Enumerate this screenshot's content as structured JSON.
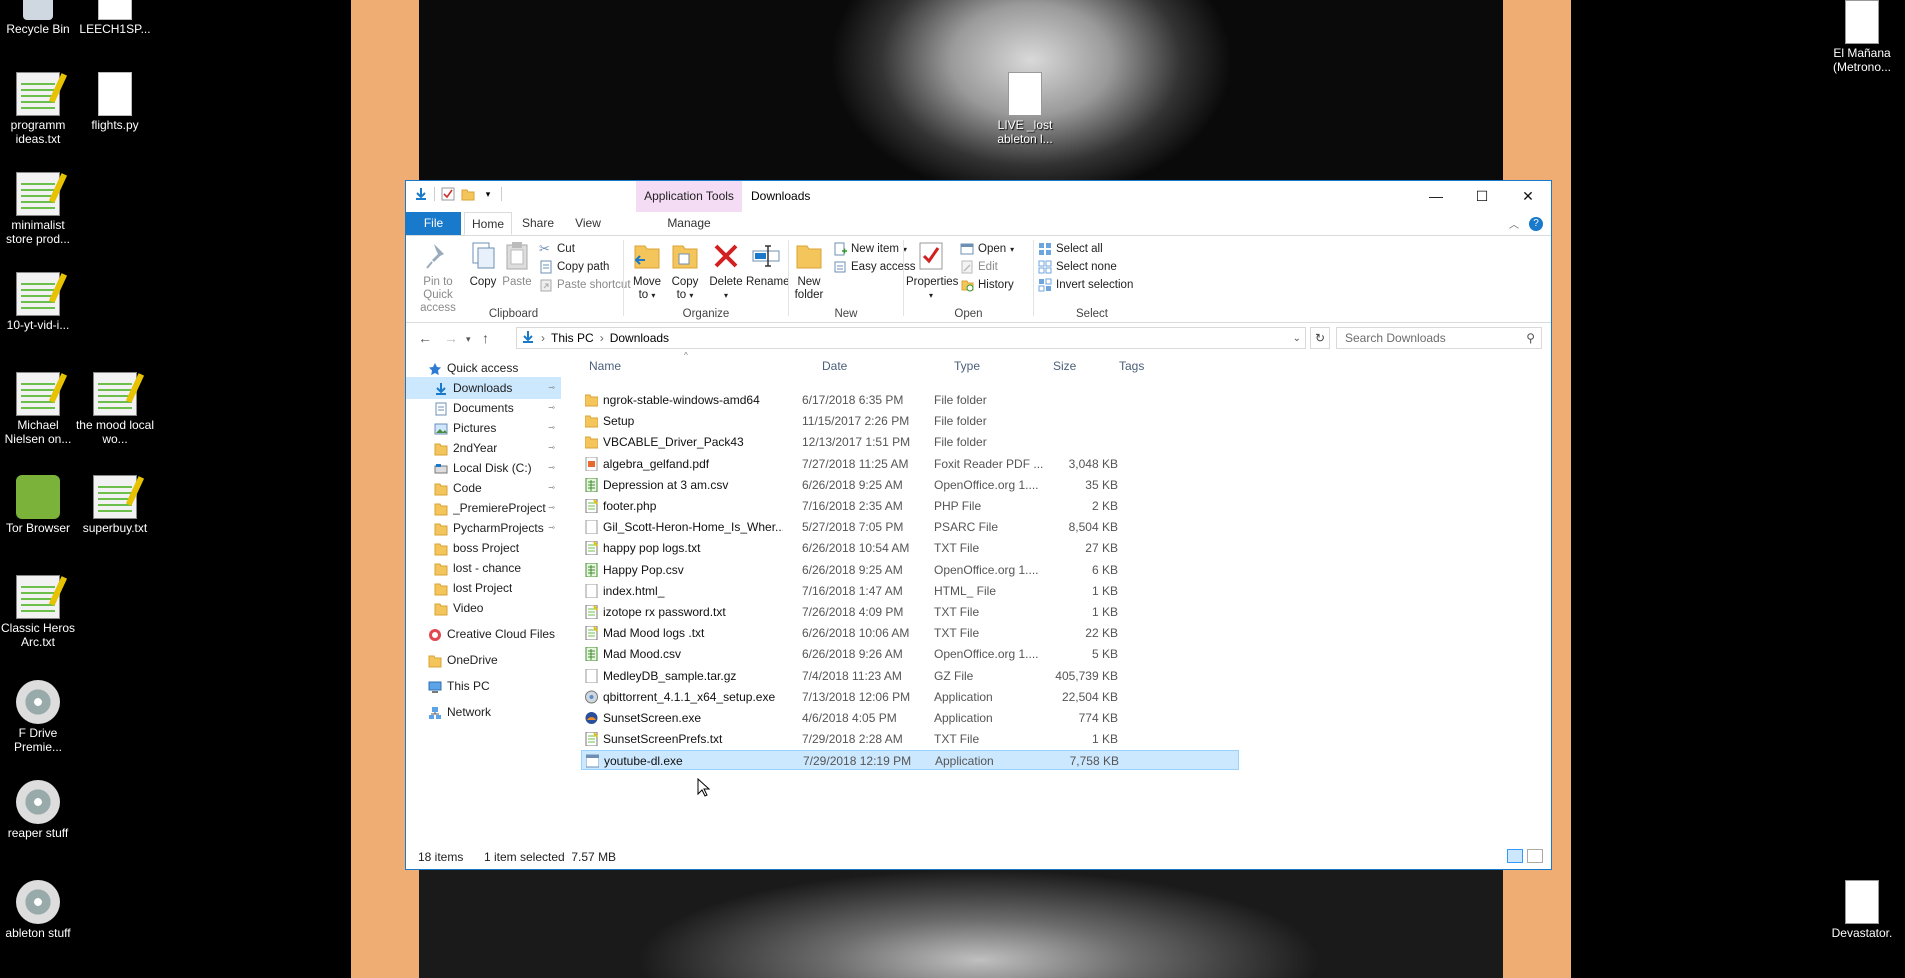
{
  "desktop": {
    "icons": [
      {
        "label": "Recycle Bin",
        "icon": "recycle-bin-icon"
      },
      {
        "label": "LEECH1SP...",
        "icon": "file-icon"
      },
      {
        "label": "programm ideas.txt",
        "icon": "notepad-icon"
      },
      {
        "label": "flights.py",
        "icon": "file-icon"
      },
      {
        "label": "minimalist store prod...",
        "icon": "notepad-icon"
      },
      {
        "label": "10-yt-vid-i...",
        "icon": "notepad-icon"
      },
      {
        "label": "Michael Nielsen on...",
        "icon": "notepad-icon"
      },
      {
        "label": "the mood local wo...",
        "icon": "notepad-icon"
      },
      {
        "label": "Tor Browser",
        "icon": "tor-icon"
      },
      {
        "label": "superbuy.txt",
        "icon": "notepad-icon"
      },
      {
        "label": "Classic Heros Arc.txt",
        "icon": "notepad-icon"
      },
      {
        "label": "F Drive Premie...",
        "icon": "disc-shortcut-icon"
      },
      {
        "label": "reaper stuff",
        "icon": "disc-shortcut-icon"
      },
      {
        "label": "ableton stuff",
        "icon": "disc-shortcut-icon"
      },
      {
        "label": "LIVE _lost ableton l...",
        "icon": "ableton-shortcut-icon"
      },
      {
        "label": "El Mañana (Metrono...",
        "icon": "music-file-icon"
      },
      {
        "label": "Devastator.",
        "icon": "music-file-icon"
      }
    ]
  },
  "window": {
    "title": "Downloads",
    "contextual_tab_group": "Application Tools",
    "controls": {
      "minimize": "—",
      "maximize": "☐",
      "close": "✕"
    },
    "tabs": {
      "file": "File",
      "home": "Home",
      "share": "Share",
      "view": "View",
      "manage": "Manage"
    },
    "ribbon": {
      "clipboard": {
        "label": "Clipboard",
        "pin": "Pin to Quick access",
        "copy": "Copy",
        "paste": "Paste",
        "cut": "Cut",
        "copy_path": "Copy path",
        "paste_shortcut": "Paste shortcut"
      },
      "organize": {
        "label": "Organize",
        "move_to": "Move to",
        "copy_to": "Copy to",
        "delete": "Delete",
        "rename": "Rename"
      },
      "new": {
        "label": "New",
        "new_folder": "New folder",
        "new_item": "New item",
        "easy_access": "Easy access"
      },
      "open": {
        "label": "Open",
        "properties": "Properties",
        "open": "Open",
        "edit": "Edit",
        "history": "History"
      },
      "select": {
        "label": "Select",
        "select_all": "Select all",
        "select_none": "Select none",
        "invert": "Invert selection"
      }
    },
    "address": {
      "crumbs": [
        "This PC",
        "Downloads"
      ],
      "search_placeholder": "Search Downloads"
    },
    "nav": [
      {
        "label": "Quick access",
        "indent": 0,
        "pinned": false,
        "selected": false,
        "icon": "star-icon"
      },
      {
        "label": "Downloads",
        "indent": 1,
        "pinned": true,
        "selected": true,
        "icon": "download-arrow-icon"
      },
      {
        "label": "Documents",
        "indent": 1,
        "pinned": true,
        "selected": false,
        "icon": "documents-icon"
      },
      {
        "label": "Pictures",
        "indent": 1,
        "pinned": true,
        "selected": false,
        "icon": "pictures-icon"
      },
      {
        "label": "2ndYear",
        "indent": 1,
        "pinned": true,
        "selected": false,
        "icon": "folder-icon"
      },
      {
        "label": "Local Disk (C:)",
        "indent": 1,
        "pinned": true,
        "selected": false,
        "icon": "drive-icon"
      },
      {
        "label": "Code",
        "indent": 1,
        "pinned": true,
        "selected": false,
        "icon": "folder-icon"
      },
      {
        "label": "_PremiereProject",
        "indent": 1,
        "pinned": true,
        "selected": false,
        "icon": "folder-icon"
      },
      {
        "label": "PycharmProjects",
        "indent": 1,
        "pinned": true,
        "selected": false,
        "icon": "folder-icon"
      },
      {
        "label": "boss Project",
        "indent": 1,
        "pinned": false,
        "selected": false,
        "icon": "folder-icon"
      },
      {
        "label": "lost - chance",
        "indent": 1,
        "pinned": false,
        "selected": false,
        "icon": "folder-icon"
      },
      {
        "label": "lost Project",
        "indent": 1,
        "pinned": false,
        "selected": false,
        "icon": "folder-icon"
      },
      {
        "label": "Video",
        "indent": 1,
        "pinned": false,
        "selected": false,
        "icon": "folder-icon"
      },
      {
        "label": "Creative Cloud Files",
        "indent": 0,
        "pinned": false,
        "selected": false,
        "icon": "creative-cloud-icon"
      },
      {
        "label": "OneDrive",
        "indent": 0,
        "pinned": false,
        "selected": false,
        "icon": "onedrive-icon"
      },
      {
        "label": "This PC",
        "indent": 0,
        "pinned": false,
        "selected": false,
        "icon": "computer-icon"
      },
      {
        "label": "Network",
        "indent": 0,
        "pinned": false,
        "selected": false,
        "icon": "network-icon"
      }
    ],
    "columns": {
      "name": "Name",
      "date": "Date",
      "type": "Type",
      "size": "Size",
      "tags": "Tags"
    },
    "files": [
      {
        "name": "ngrok-stable-windows-amd64",
        "date": "6/17/2018 6:35 PM",
        "type": "File folder",
        "size": "",
        "icon": "folder-icon",
        "selected": false
      },
      {
        "name": "Setup",
        "date": "11/15/2017 2:26 PM",
        "type": "File folder",
        "size": "",
        "icon": "folder-icon",
        "selected": false
      },
      {
        "name": "VBCABLE_Driver_Pack43",
        "date": "12/13/2017 1:51 PM",
        "type": "File folder",
        "size": "",
        "icon": "folder-icon",
        "selected": false
      },
      {
        "name": "algebra_gelfand.pdf",
        "date": "7/27/2018 11:25 AM",
        "type": "Foxit Reader PDF ...",
        "size": "3,048 KB",
        "icon": "pdf-icon",
        "selected": false
      },
      {
        "name": "Depression at 3 am.csv",
        "date": "6/26/2018 9:25 AM",
        "type": "OpenOffice.org 1....",
        "size": "35 KB",
        "icon": "spreadsheet-icon",
        "selected": false
      },
      {
        "name": "footer.php",
        "date": "7/16/2018 2:35 AM",
        "type": "PHP File",
        "size": "2 KB",
        "icon": "notepad-icon",
        "selected": false
      },
      {
        "name": "Gil_Scott-Heron-Home_Is_Wher...",
        "date": "5/27/2018 7:05 PM",
        "type": "PSARC File",
        "size": "8,504 KB",
        "icon": "file-icon",
        "selected": false
      },
      {
        "name": "happy pop logs.txt",
        "date": "6/26/2018 10:54 AM",
        "type": "TXT File",
        "size": "27 KB",
        "icon": "notepad-icon",
        "selected": false
      },
      {
        "name": "Happy Pop.csv",
        "date": "6/26/2018 9:25 AM",
        "type": "OpenOffice.org 1....",
        "size": "6 KB",
        "icon": "spreadsheet-icon",
        "selected": false
      },
      {
        "name": "index.html_",
        "date": "7/16/2018 1:47 AM",
        "type": "HTML_ File",
        "size": "1 KB",
        "icon": "file-icon",
        "selected": false
      },
      {
        "name": "izotope rx password.txt",
        "date": "7/26/2018 4:09 PM",
        "type": "TXT File",
        "size": "1 KB",
        "icon": "notepad-icon",
        "selected": false
      },
      {
        "name": "Mad Mood logs .txt",
        "date": "6/26/2018 10:06 AM",
        "type": "TXT File",
        "size": "22 KB",
        "icon": "notepad-icon",
        "selected": false
      },
      {
        "name": "Mad Mood.csv",
        "date": "6/26/2018 9:26 AM",
        "type": "OpenOffice.org 1....",
        "size": "5 KB",
        "icon": "spreadsheet-icon",
        "selected": false
      },
      {
        "name": "MedleyDB_sample.tar.gz",
        "date": "7/4/2018 11:23 AM",
        "type": "GZ File",
        "size": "405,739 KB",
        "icon": "file-icon",
        "selected": false
      },
      {
        "name": "qbittorrent_4.1.1_x64_setup.exe",
        "date": "7/13/2018 12:06 PM",
        "type": "Application",
        "size": "22,504 KB",
        "icon": "installer-icon",
        "selected": false
      },
      {
        "name": "SunsetScreen.exe",
        "date": "4/6/2018 4:05 PM",
        "type": "Application",
        "size": "774 KB",
        "icon": "app-icon",
        "selected": false
      },
      {
        "name": "SunsetScreenPrefs.txt",
        "date": "7/29/2018 2:28 AM",
        "type": "TXT File",
        "size": "1 KB",
        "icon": "notepad-icon",
        "selected": false
      },
      {
        "name": "youtube-dl.exe",
        "date": "7/29/2018 12:19 PM",
        "type": "Application",
        "size": "7,758 KB",
        "icon": "exe-icon",
        "selected": true
      }
    ],
    "status": {
      "count": "18 items",
      "selection": "1 item selected  7.57 MB"
    },
    "colors": {
      "accent": "#1979ca",
      "selection": "#cce8ff",
      "contextual_tab": "#f5dcf5",
      "wallpaper_border": "#efad73"
    }
  }
}
